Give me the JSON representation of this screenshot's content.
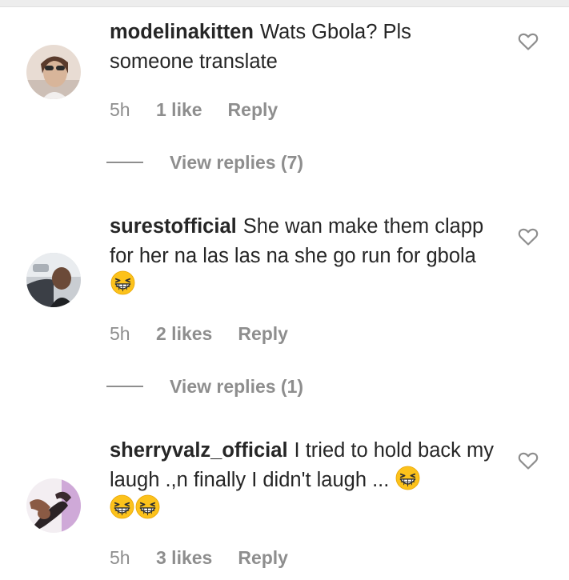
{
  "comments": [
    {
      "username": "modelinakitten",
      "text": "Wats Gbola? Pls someone translate",
      "emojis": [],
      "time": "5h",
      "likes": "1 like",
      "reply_label": "Reply",
      "view_replies": "View replies (7)",
      "avatar_icon": "profile-photo"
    },
    {
      "username": "surestofficial",
      "text": "She wan make them clapp for her na las las na she go run for gbola",
      "emojis": [
        "grinning-squinting-face"
      ],
      "time": "5h",
      "likes": "2 likes",
      "reply_label": "Reply",
      "view_replies": "View replies (1)",
      "avatar_icon": "profile-photo"
    },
    {
      "username": "sherryvalz_official",
      "text": "I tried to hold back my laugh .,n finally I didn't laugh ...",
      "emojis": [
        "grinning-squinting-face",
        "grinning-squinting-face",
        "grinning-squinting-face"
      ],
      "time": "5h",
      "likes": "3 likes",
      "reply_label": "Reply",
      "view_replies": "",
      "avatar_icon": "profile-photo"
    }
  ],
  "icons": {
    "like": "heart-outline-icon",
    "emoji": "grinning-squinting-face"
  },
  "colors": {
    "text": "#262626",
    "secondary": "#8e8e8e",
    "emoji_fill": "#fcc21b"
  }
}
